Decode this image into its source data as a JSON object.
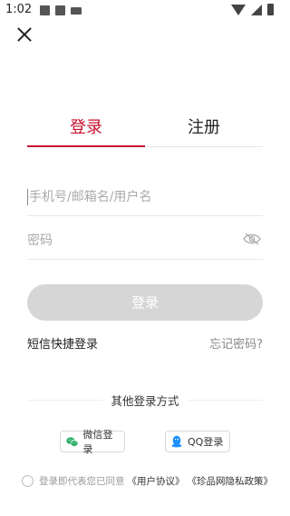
{
  "status_bar": {
    "time": "1:02"
  },
  "tabs": [
    {
      "label": "登录",
      "active": true
    },
    {
      "label": "注册",
      "active": false
    }
  ],
  "form": {
    "account_placeholder": "手机号/邮箱名/用户名",
    "password_placeholder": "密码",
    "login_label": "登录"
  },
  "links": {
    "sms_login": "短信快捷登录",
    "forgot_password": "忘记密码?"
  },
  "other_login": {
    "title": "其他登录方式",
    "wechat_label": "微信登录",
    "qq_label": "QQ登录"
  },
  "agreement": {
    "text": "登录即代表您已同意",
    "user_agreement": "《用户协议》",
    "privacy_policy": "《珍品网隐私政策》"
  },
  "colors": {
    "accent": "#c8102e",
    "button_disabled": "#d6d6d6",
    "wechat": "#2aae67",
    "qq": "#1e90ff"
  },
  "icons": {
    "close": "close-icon",
    "password_visibility": "eye-off-icon",
    "wechat": "wechat-icon",
    "qq": "qq-icon",
    "agreement_checkbox": "radio-icon"
  }
}
